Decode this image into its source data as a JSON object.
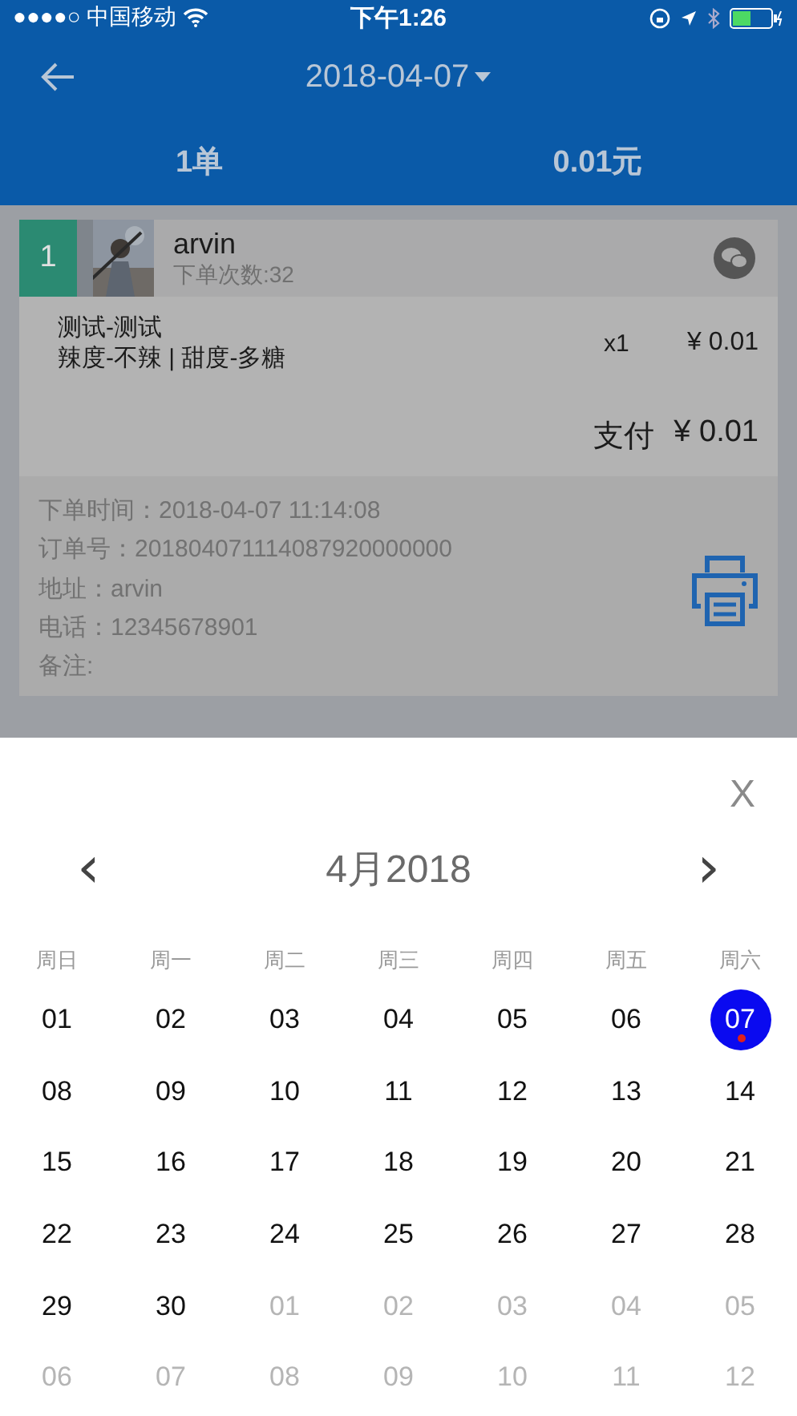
{
  "status_bar": {
    "carrier": "●●●●○ 中国移动",
    "time": "下午1:26"
  },
  "header": {
    "date": "2018-04-07"
  },
  "totals": {
    "orders": "1单",
    "amount": "0.01元"
  },
  "order": {
    "index": "1",
    "customer": "arvin",
    "order_count": "下单次数:32",
    "items": [
      {
        "name": "测试-测试",
        "options": "辣度-不辣 | 甜度-多糖",
        "qty": "x1",
        "price": "¥ 0.01"
      }
    ],
    "pay_label": "支付",
    "pay_amount": "¥ 0.01",
    "details": [
      "下单时间：2018-04-07 11:14:08",
      "订单号：201804071114087920000000",
      "地址：arvin",
      "电话：12345678901",
      "备注:"
    ]
  },
  "calendar": {
    "close": "X",
    "prev": "‹",
    "next": "›",
    "month": "4月2018",
    "weekdays": [
      "周日",
      "周一",
      "周二",
      "周三",
      "周四",
      "周五",
      "周六"
    ],
    "weeks": [
      [
        {
          "day": "01",
          "muted": false,
          "selected": false,
          "marked": false
        },
        {
          "day": "02",
          "muted": false,
          "selected": false,
          "marked": false
        },
        {
          "day": "03",
          "muted": false,
          "selected": false,
          "marked": false
        },
        {
          "day": "04",
          "muted": false,
          "selected": false,
          "marked": false
        },
        {
          "day": "05",
          "muted": false,
          "selected": false,
          "marked": false
        },
        {
          "day": "06",
          "muted": false,
          "selected": false,
          "marked": false
        },
        {
          "day": "07",
          "muted": false,
          "selected": true,
          "marked": true
        }
      ],
      [
        {
          "day": "08",
          "muted": false,
          "selected": false,
          "marked": false
        },
        {
          "day": "09",
          "muted": false,
          "selected": false,
          "marked": false
        },
        {
          "day": "10",
          "muted": false,
          "selected": false,
          "marked": false
        },
        {
          "day": "11",
          "muted": false,
          "selected": false,
          "marked": false
        },
        {
          "day": "12",
          "muted": false,
          "selected": false,
          "marked": false
        },
        {
          "day": "13",
          "muted": false,
          "selected": false,
          "marked": false
        },
        {
          "day": "14",
          "muted": false,
          "selected": false,
          "marked": false
        }
      ],
      [
        {
          "day": "15",
          "muted": false,
          "selected": false,
          "marked": false
        },
        {
          "day": "16",
          "muted": false,
          "selected": false,
          "marked": false
        },
        {
          "day": "17",
          "muted": false,
          "selected": false,
          "marked": false
        },
        {
          "day": "18",
          "muted": false,
          "selected": false,
          "marked": false
        },
        {
          "day": "19",
          "muted": false,
          "selected": false,
          "marked": false
        },
        {
          "day": "20",
          "muted": false,
          "selected": false,
          "marked": false
        },
        {
          "day": "21",
          "muted": false,
          "selected": false,
          "marked": false
        }
      ],
      [
        {
          "day": "22",
          "muted": false,
          "selected": false,
          "marked": false
        },
        {
          "day": "23",
          "muted": false,
          "selected": false,
          "marked": false
        },
        {
          "day": "24",
          "muted": false,
          "selected": false,
          "marked": false
        },
        {
          "day": "25",
          "muted": false,
          "selected": false,
          "marked": false
        },
        {
          "day": "26",
          "muted": false,
          "selected": false,
          "marked": false
        },
        {
          "day": "27",
          "muted": false,
          "selected": false,
          "marked": false
        },
        {
          "day": "28",
          "muted": false,
          "selected": false,
          "marked": false
        }
      ],
      [
        {
          "day": "29",
          "muted": false,
          "selected": false,
          "marked": false
        },
        {
          "day": "30",
          "muted": false,
          "selected": false,
          "marked": false
        },
        {
          "day": "01",
          "muted": true,
          "selected": false,
          "marked": false
        },
        {
          "day": "02",
          "muted": true,
          "selected": false,
          "marked": false
        },
        {
          "day": "03",
          "muted": true,
          "selected": false,
          "marked": false
        },
        {
          "day": "04",
          "muted": true,
          "selected": false,
          "marked": false
        },
        {
          "day": "05",
          "muted": true,
          "selected": false,
          "marked": false
        }
      ],
      [
        {
          "day": "06",
          "muted": true,
          "selected": false,
          "marked": false
        },
        {
          "day": "07",
          "muted": true,
          "selected": false,
          "marked": false
        },
        {
          "day": "08",
          "muted": true,
          "selected": false,
          "marked": false
        },
        {
          "day": "09",
          "muted": true,
          "selected": false,
          "marked": false
        },
        {
          "day": "10",
          "muted": true,
          "selected": false,
          "marked": false
        },
        {
          "day": "11",
          "muted": true,
          "selected": false,
          "marked": false
        },
        {
          "day": "12",
          "muted": true,
          "selected": false,
          "marked": false
        }
      ]
    ]
  }
}
